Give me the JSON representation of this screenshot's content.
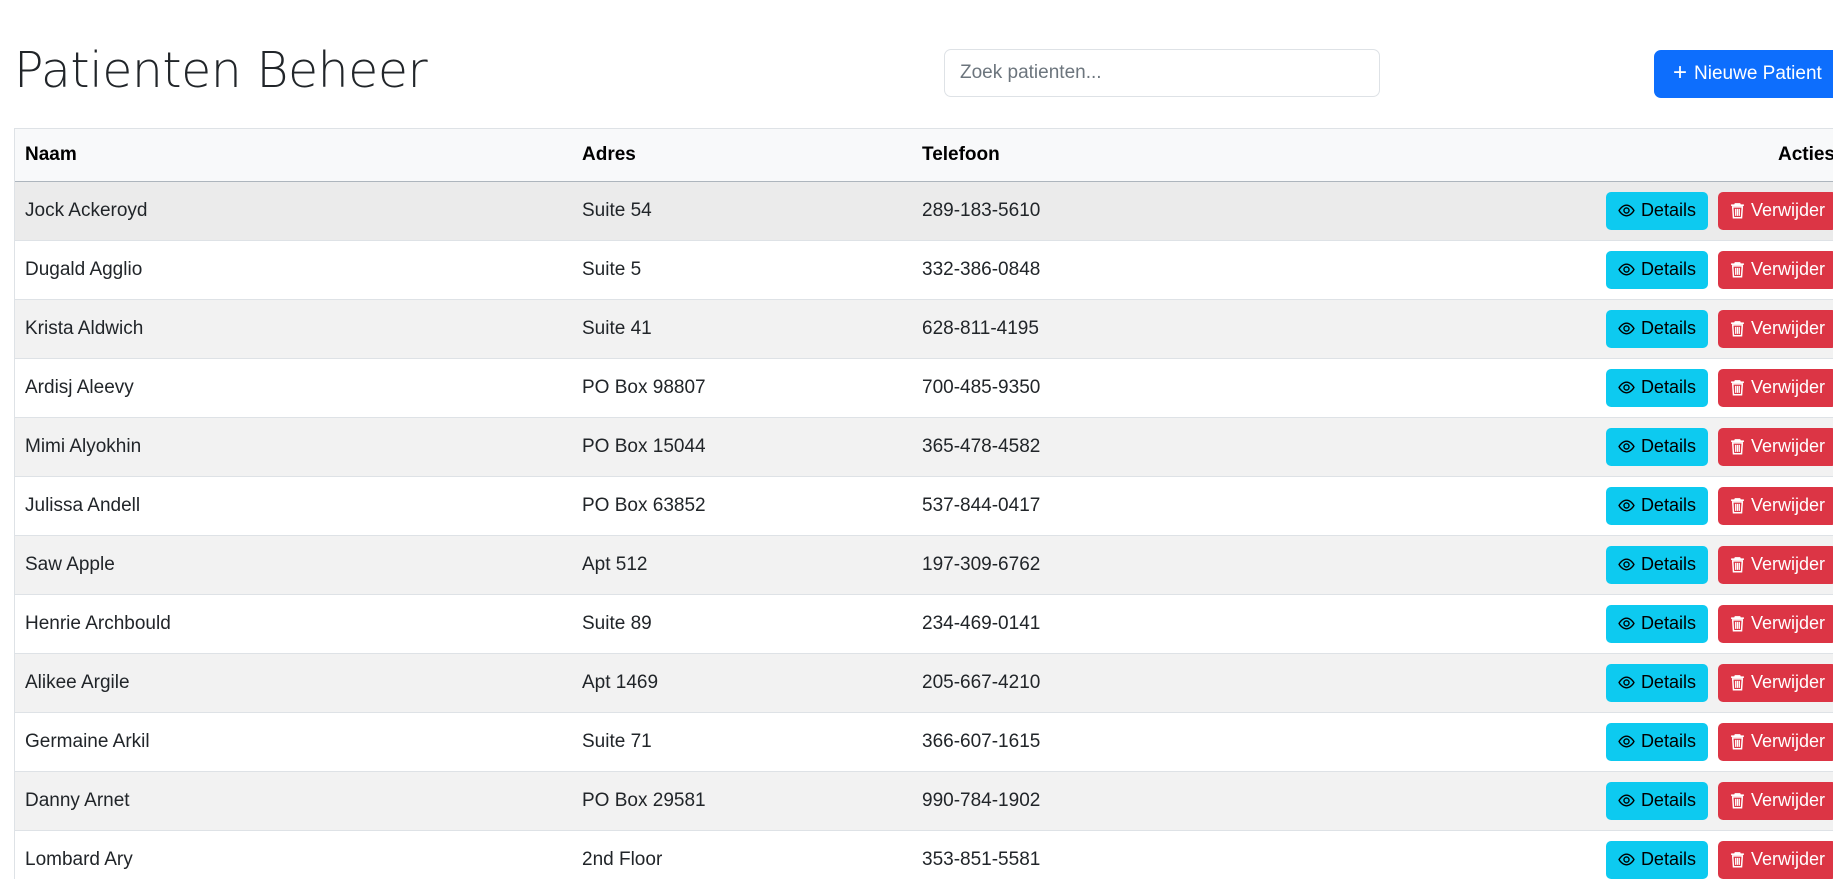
{
  "header": {
    "title": "Patienten Beheer",
    "search_placeholder": "Zoek patienten...",
    "new_button_label": "Nieuwe Patient"
  },
  "table": {
    "columns": [
      "Naam",
      "Adres",
      "Telefoon",
      "Acties"
    ],
    "details_label": "Details",
    "delete_label": "Verwijder",
    "rows": [
      {
        "name": "Jock Ackeroyd",
        "address": "Suite 54",
        "phone": "289-183-5610"
      },
      {
        "name": "Dugald Agglio",
        "address": "Suite 5",
        "phone": "332-386-0848"
      },
      {
        "name": "Krista Aldwich",
        "address": "Suite 41",
        "phone": "628-811-4195"
      },
      {
        "name": "Ardisj Aleevy",
        "address": "PO Box 98807",
        "phone": "700-485-9350"
      },
      {
        "name": "Mimi Alyokhin",
        "address": "PO Box 15044",
        "phone": "365-478-4582"
      },
      {
        "name": "Julissa Andell",
        "address": "PO Box 63852",
        "phone": "537-844-0417"
      },
      {
        "name": "Saw Apple",
        "address": "Apt 512",
        "phone": "197-309-6762"
      },
      {
        "name": "Henrie Archbould",
        "address": "Suite 89",
        "phone": "234-469-0141"
      },
      {
        "name": "Alikee Argile",
        "address": "Apt 1469",
        "phone": "205-667-4210"
      },
      {
        "name": "Germaine Arkil",
        "address": "Suite 71",
        "phone": "366-607-1615"
      },
      {
        "name": "Danny Arnet",
        "address": "PO Box 29581",
        "phone": "990-784-1902"
      },
      {
        "name": "Lombard Ary",
        "address": "2nd Floor",
        "phone": "353-851-5581"
      }
    ]
  },
  "colors": {
    "primary": "#0d6efd",
    "info": "#0dcaf0",
    "danger": "#dc3545"
  },
  "icons": {
    "new_button": "plus-icon",
    "details_button": "eye-icon",
    "delete_button": "trash-icon"
  }
}
